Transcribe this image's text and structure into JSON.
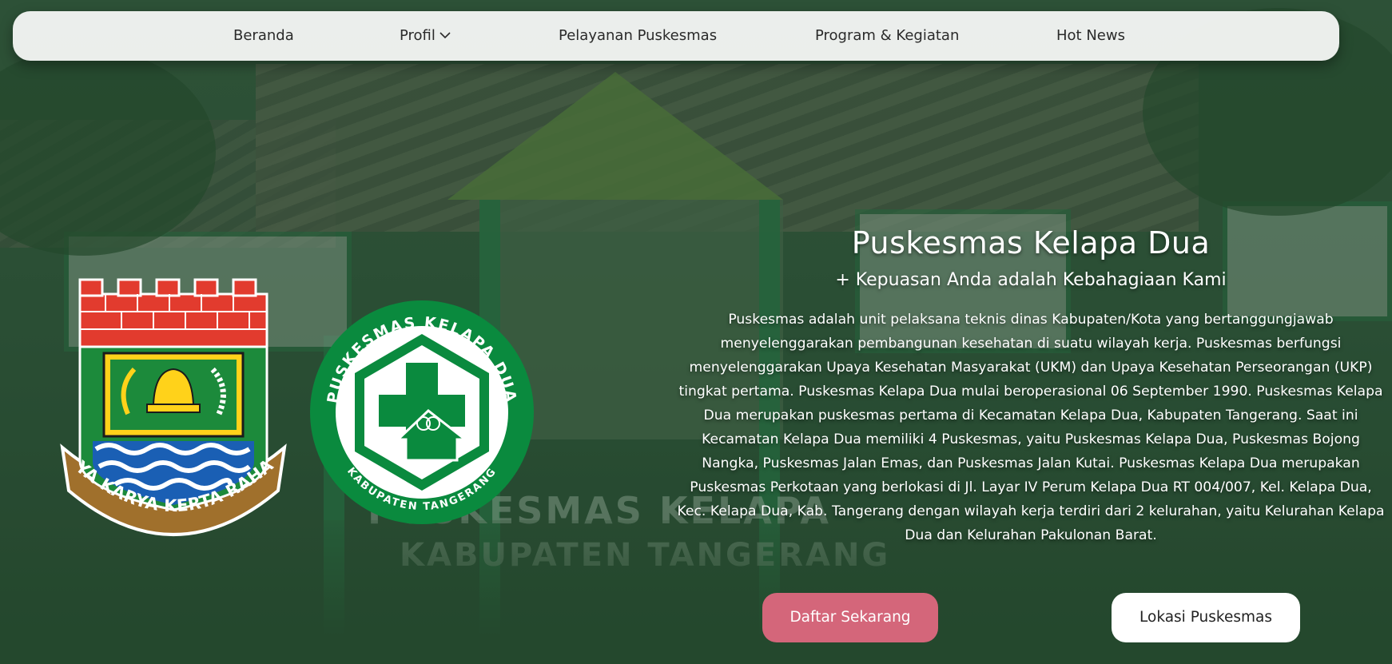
{
  "nav": {
    "items": [
      {
        "label": "Beranda"
      },
      {
        "label": "Profil",
        "icon": "chevron-down-icon"
      },
      {
        "label": "Pelayanan Puskesmas"
      },
      {
        "label": "Program & Kegiatan"
      },
      {
        "label": "Hot News"
      }
    ]
  },
  "hero": {
    "title": "Puskesmas Kelapa Dua",
    "subtitle": "+ Kepuasan Anda adalah Kebahagiaan Kami",
    "description": "Puskesmas adalah unit pelaksana teknis dinas Kabupaten/Kota yang bertanggungjawab menyelenggarakan pembangunan kesehatan di suatu wilayah kerja. Puskesmas berfungsi menyelenggarakan Upaya Kesehatan Masyarakat (UKM) dan Upaya Kesehatan Perseorangan (UKP) tingkat pertama. Puskesmas Kelapa Dua mulai beroperasional 06 September 1990. Puskesmas Kelapa Dua merupakan puskesmas pertama di Kecamatan Kelapa Dua, Kabupaten Tangerang. Saat ini Kecamatan Kelapa Dua memiliki 4 Puskesmas, yaitu Puskesmas Kelapa Dua, Puskesmas Bojong Nangka, Puskesmas Jalan Emas, dan Puskesmas Jalan Kutai. Puskesmas Kelapa Dua merupakan Puskesmas Perkotaan yang berlokasi di Jl. Layar IV Perum Kelapa Dua RT 004/007, Kel. Kelapa Dua, Kec. Kelapa Dua, Kab. Tangerang dengan wilayah kerja terdiri dari 2 kelurahan, yaitu Kelurahan Kelapa Dua dan Kelurahan Pakulonan Barat.",
    "primary_button": "Daftar Sekarang",
    "secondary_button": "Lokasi Puskesmas"
  },
  "logos": {
    "regency_motto": "SATYA KARYA KERTA RAHARJA",
    "puskesmas_ring_top": "PUSKESMAS KELAPA DUA",
    "puskesmas_ring_bottom": "KABUPATEN TANGERANG"
  },
  "colors": {
    "navbar_bg": "#f5f7f5",
    "primary_button": "#d4667a",
    "secondary_button": "#ffffff",
    "logo_green": "#0a8a3e",
    "overlay": "#19462880"
  }
}
